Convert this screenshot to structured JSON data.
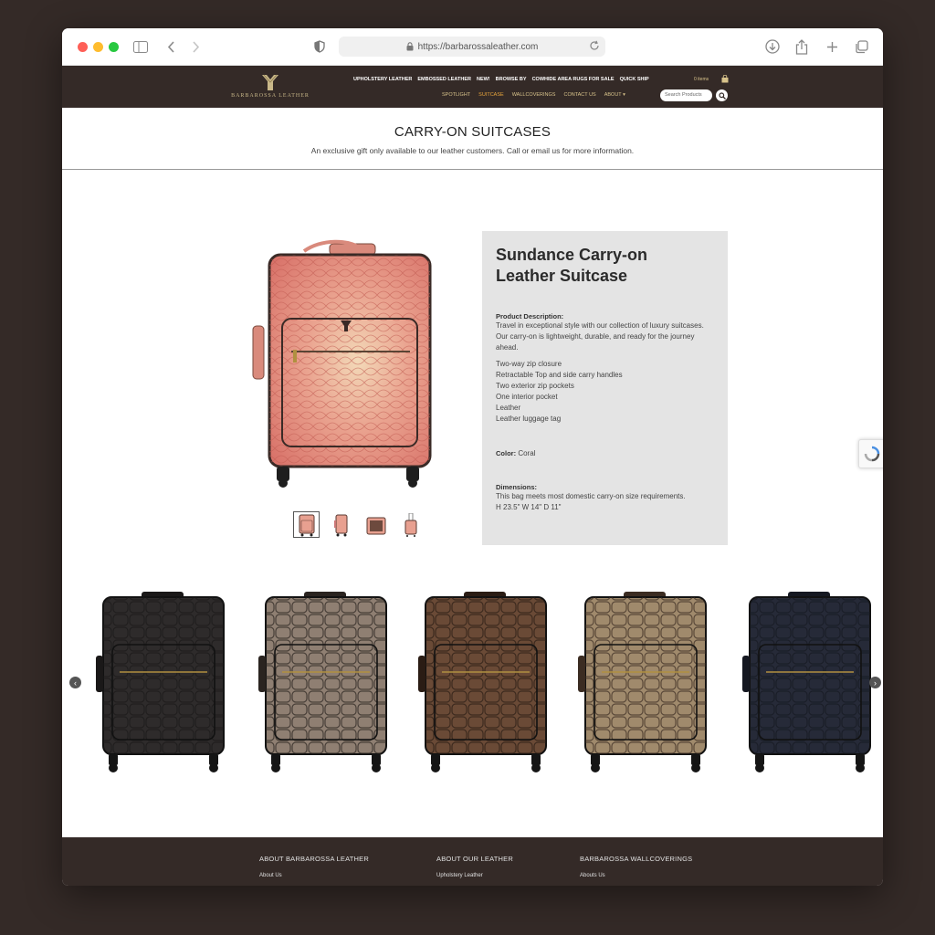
{
  "browser": {
    "url": "https://barbarossaleather.com"
  },
  "header": {
    "logo_text": "BARBAROSSA LEATHER",
    "nav_top": [
      "UPHOLSTERY LEATHER",
      "EMBOSSED LEATHER",
      "NEW!",
      "BROWSE BY",
      "COWHIDE AREA RUGS FOR SALE",
      "QUICK SHIP"
    ],
    "cart_text": "0 items",
    "nav_bottom": [
      "SPOTLIGHT",
      "SUITCASE",
      "WALLCOVERINGS",
      "CONTACT US",
      "ABOUT"
    ],
    "active_nav": "SUITCASE",
    "search_placeholder": "Search Products"
  },
  "page": {
    "title": "CARRY-ON SUITCASES",
    "subtitle": "An exclusive gift only available to our leather customers. Call or email us for more information."
  },
  "product": {
    "name_line1": "Sundance Carry-on",
    "name_line2": "Leather Suitcase",
    "desc_label": "Product Description:",
    "desc_text": "Travel in exceptional style with our collection of luxury suitcases. Our carry-on is lightweight, durable, and ready for the journey ahead.",
    "features": [
      "Two-way zip closure",
      "Retractable Top and side carry handles",
      "Two exterior zip pockets",
      "One interior pocket",
      "Leather",
      "Leather luggage tag"
    ],
    "color_label": "Color:",
    "color_value": "Coral",
    "dim_label": "Dimensions:",
    "dim_text1": "This bag meets most domestic carry-on size requirements.",
    "dim_text2": "H 23.5\" W 14\" D 11\""
  },
  "carousel": {
    "items": [
      {
        "name": "black-croc-suitcase",
        "color": "#2e2b2b",
        "accent": "#1a1818"
      },
      {
        "name": "metallic-croc-suitcase",
        "color": "#8f7f72",
        "accent": "#2a2420"
      },
      {
        "name": "bronze-croc-suitcase",
        "color": "#6a4a36",
        "accent": "#2a1c14"
      },
      {
        "name": "tan-embossed-suitcase",
        "color": "#a08a6c",
        "accent": "#3b2c22"
      },
      {
        "name": "navy-croc-suitcase",
        "color": "#262a38",
        "accent": "#151821"
      }
    ]
  },
  "footer": {
    "columns": [
      {
        "heading": "ABOUT BARBAROSSA LEATHER",
        "link": "About Us"
      },
      {
        "heading": "ABOUT OUR LEATHER",
        "link": "Upholstery Leather"
      },
      {
        "heading": "BARBAROSSA WALLCOVERINGS",
        "link": "Abouts Us"
      }
    ]
  },
  "colors": {
    "brand_dark": "#342a27",
    "gold": "#d8c38b",
    "active_orange": "#e8a53c",
    "coral": "#e68880"
  }
}
